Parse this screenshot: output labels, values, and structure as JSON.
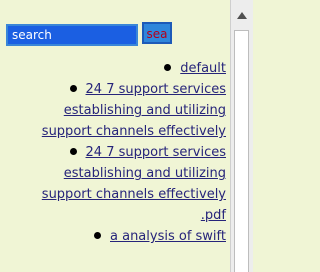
{
  "search": {
    "value": "search",
    "button_label": "sea"
  },
  "links": {
    "item1": "default",
    "item2_line1": "24 7 support services",
    "item2_line2": "establishing and utilizing",
    "item2_line3": "support channels effectively",
    "item3_line1": "24 7 support services",
    "item3_line2": "establishing and utilizing",
    "item3_line3": "support channels effectively",
    "item3_line4": ".pdf",
    "item4_line1": "a analysis of swift"
  },
  "colors": {
    "background": "#f0f5d5",
    "link": "#26247a",
    "search_input_bg": "#1b5fe2",
    "search_button_bg": "#2f86db",
    "search_button_text": "#b3001b"
  },
  "icons": {
    "scroll_up": "triangle-up-icon",
    "bullet": "disc-bullet-icon"
  }
}
